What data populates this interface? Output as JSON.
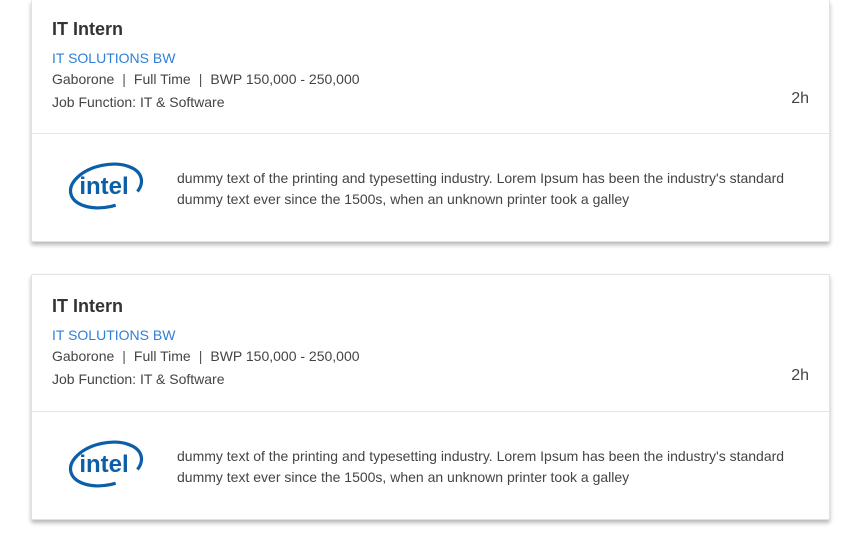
{
  "jobs": [
    {
      "title": "IT Intern",
      "company": "IT SOLUTIONS BW",
      "location": "Gaborone",
      "separator": "|",
      "employment_type": "Full Time",
      "salary": "BWP 150,000 - 250,000",
      "job_function": "Job Function: IT & Software",
      "posted": "2h",
      "logo": {
        "icon": "intel-logo",
        "text": "intel",
        "color": "#0b5ea8"
      },
      "description": "dummy text of the printing and typesetting industry. Lorem Ipsum has been the industry's standard dummy text ever since the 1500s, when an unknown printer took a galley"
    },
    {
      "title": "IT Intern",
      "company": "IT SOLUTIONS BW",
      "location": "Gaborone",
      "separator": "|",
      "employment_type": "Full Time",
      "salary": "BWP 150,000 - 250,000",
      "job_function": "Job Function: IT & Software",
      "posted": "2h",
      "logo": {
        "icon": "intel-logo",
        "text": "intel",
        "color": "#0b5ea8"
      },
      "description": "dummy text of the printing and typesetting industry. Lorem Ipsum has been the industry's standard dummy text ever since the 1500s, when an unknown printer took a galley"
    }
  ],
  "colors": {
    "accent_link": "#2f7fd8",
    "text": "#444444",
    "title": "#333333"
  }
}
